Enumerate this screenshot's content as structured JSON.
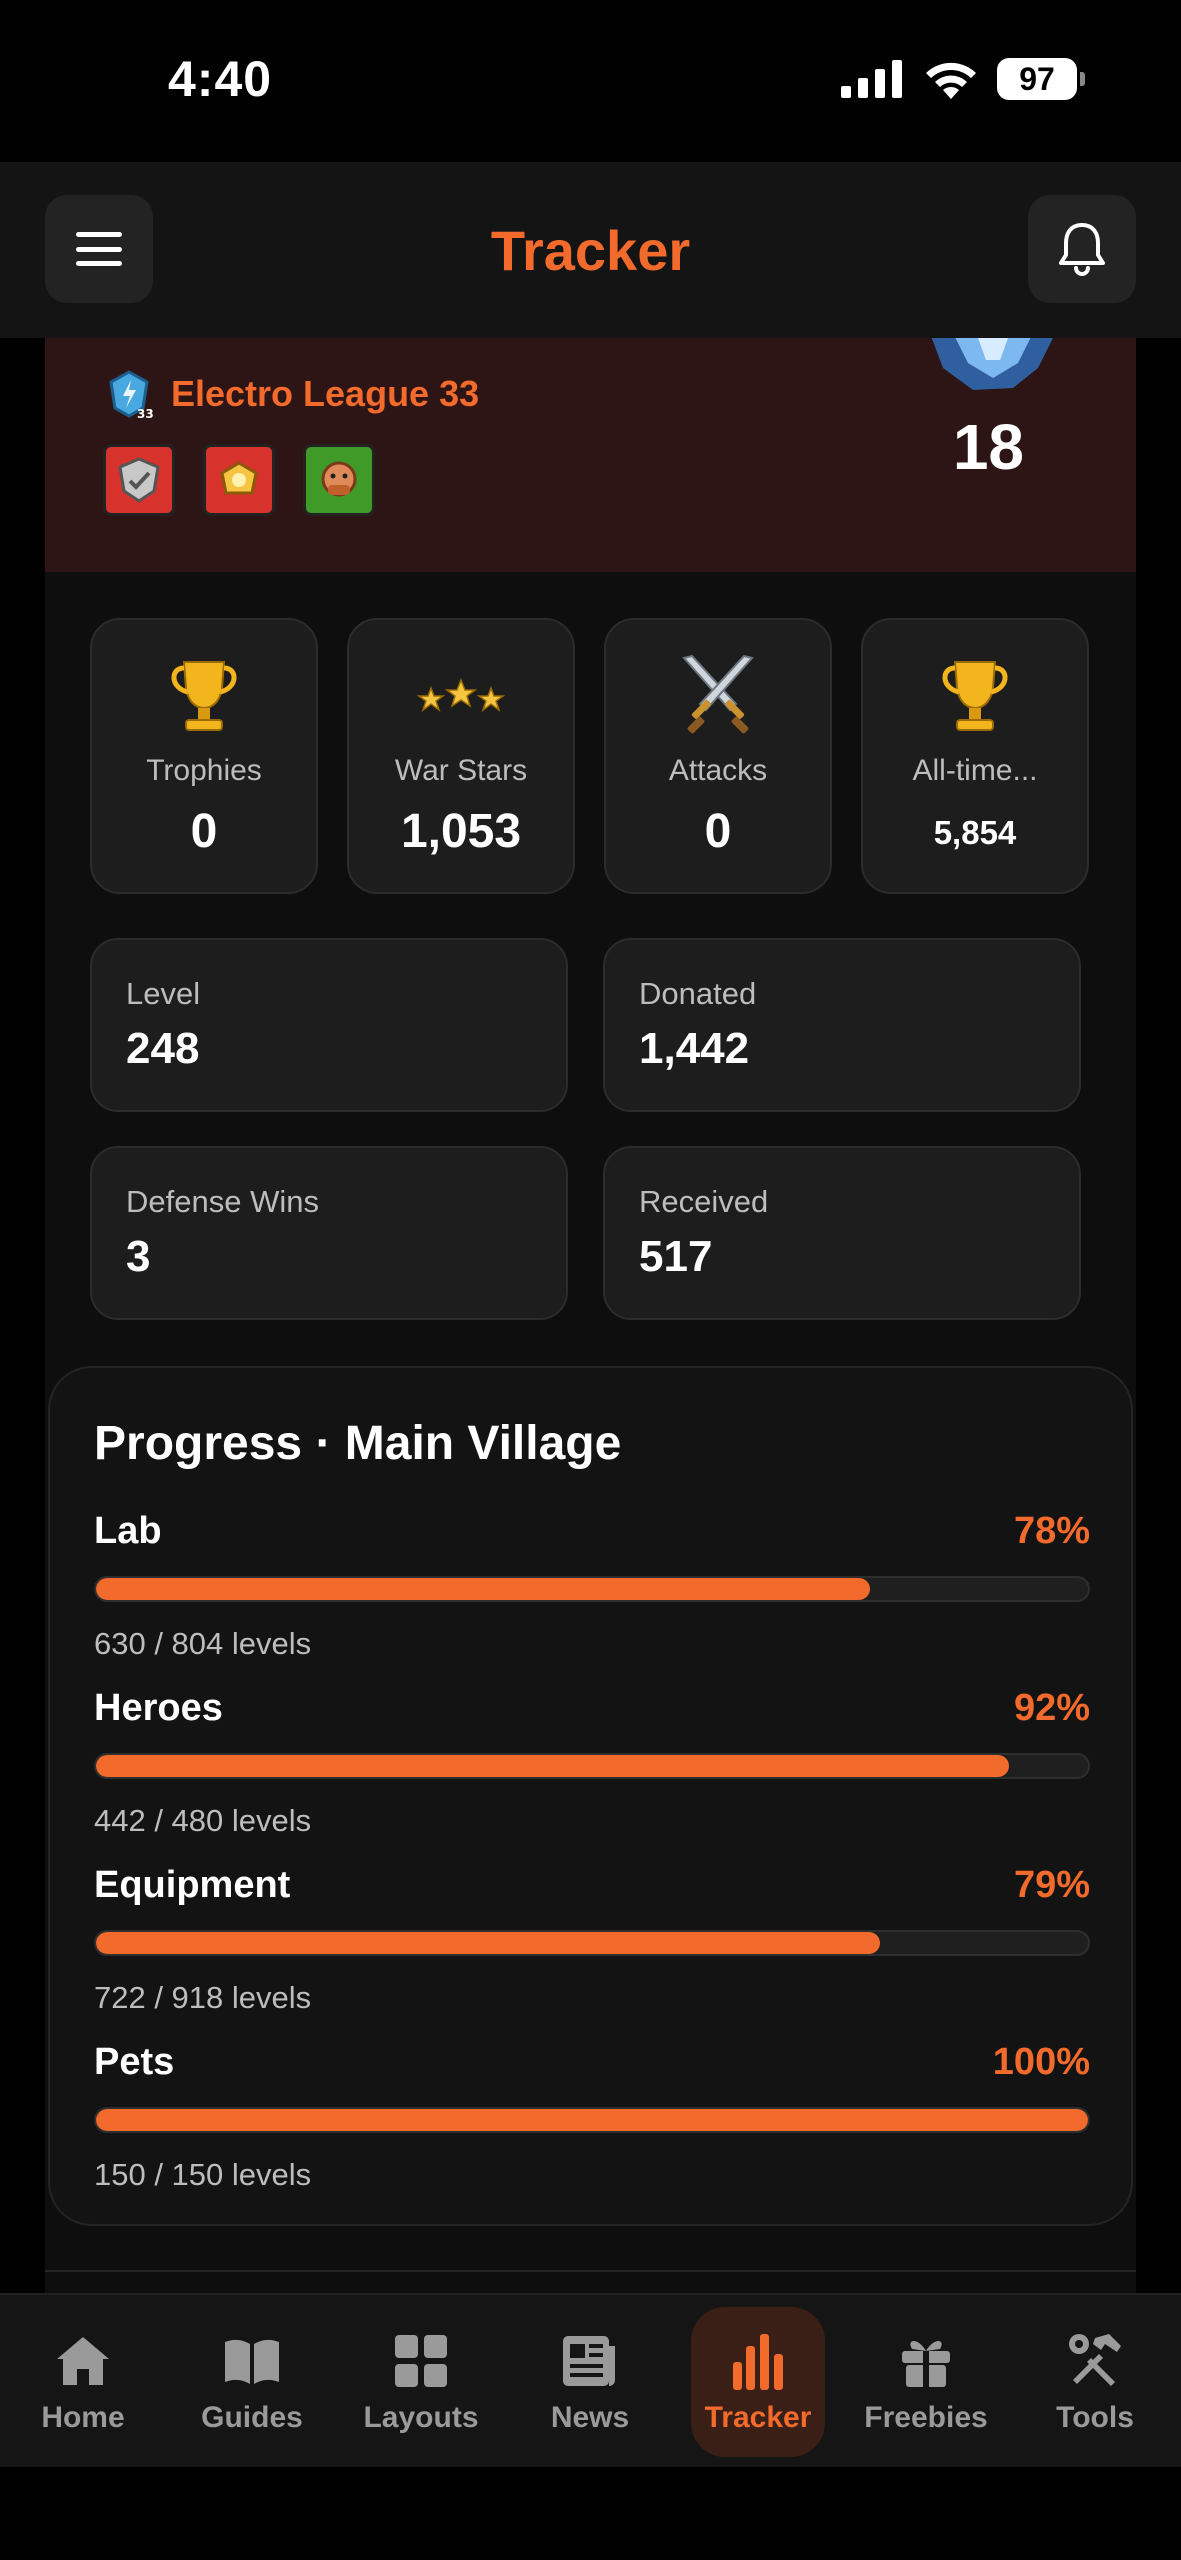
{
  "status_bar": {
    "time": "4:40",
    "battery": "97"
  },
  "header": {
    "title": "Tracker"
  },
  "league": {
    "name": "Electro League 33",
    "badge_number": "33",
    "town_hall_level": "18"
  },
  "stats": [
    {
      "label": "Trophies",
      "value": "0",
      "icon": "trophy-icon"
    },
    {
      "label": "War Stars",
      "value": "1,053",
      "icon": "stars-icon"
    },
    {
      "label": "Attacks",
      "value": "0",
      "icon": "crossed-swords-icon"
    },
    {
      "label": "All-time...",
      "value": "5,854",
      "icon": "trophy-icon"
    }
  ],
  "info": {
    "level": {
      "label": "Level",
      "value": "248"
    },
    "donated": {
      "label": "Donated",
      "value": "1,442"
    },
    "defense_wins": {
      "label": "Defense Wins",
      "value": "3"
    },
    "received": {
      "label": "Received",
      "value": "517"
    }
  },
  "progress": {
    "title": "Progress · Main Village",
    "items": [
      {
        "name": "Lab",
        "percent": "78%",
        "fraction": 0.78,
        "detail": "630 / 804 levels"
      },
      {
        "name": "Heroes",
        "percent": "92%",
        "fraction": 0.92,
        "detail": "442 / 480 levels"
      },
      {
        "name": "Equipment",
        "percent": "79%",
        "fraction": 0.79,
        "detail": "722 / 918 levels"
      },
      {
        "name": "Pets",
        "percent": "100%",
        "fraction": 1.0,
        "detail": "150 / 150 levels"
      }
    ]
  },
  "tabs": [
    {
      "label": "Home",
      "icon": "home-icon"
    },
    {
      "label": "Guides",
      "icon": "book-icon"
    },
    {
      "label": "Layouts",
      "icon": "grid-icon"
    },
    {
      "label": "News",
      "icon": "newspaper-icon"
    },
    {
      "label": "Tracker",
      "icon": "bar-chart-icon",
      "active": true
    },
    {
      "label": "Freebies",
      "icon": "gift-icon"
    },
    {
      "label": "Tools",
      "icon": "tools-icon"
    }
  ],
  "colors": {
    "accent": "#f26a2c",
    "background": "#0e0e0e",
    "card": "#1d1d1d",
    "league_band": "#2c1514"
  }
}
